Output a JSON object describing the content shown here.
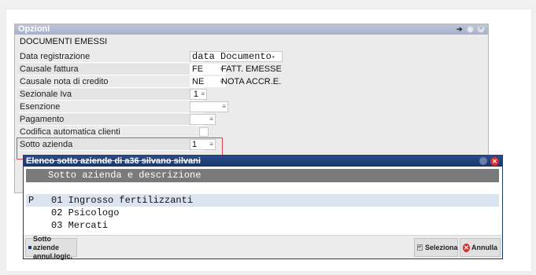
{
  "options_window": {
    "title": "Opzioni",
    "section": "DOCUMENTI EMESSI",
    "rows": [
      {
        "label": "Data registrazione",
        "value": "data Documento",
        "desc": ""
      },
      {
        "label": "Causale fattura",
        "value": "FE",
        "desc": "FATT. EMESSE"
      },
      {
        "label": "Causale nota di credito",
        "value": "NE",
        "desc": "NOTA ACCR.E."
      },
      {
        "label": "Sezionale Iva",
        "value": "1",
        "desc": ""
      },
      {
        "label": "Esenzione",
        "value": "",
        "desc": ""
      },
      {
        "label": "Pagamento",
        "value": "",
        "desc": ""
      },
      {
        "label": "Codifica automatica clienti",
        "value": "",
        "desc": ""
      },
      {
        "label": "Sotto azienda",
        "value": "1",
        "desc": ""
      }
    ],
    "list_marker": "≡",
    "dropdown_marker": "▾"
  },
  "popup": {
    "title": "Elenco sotto aziende di a36 silvano silvani",
    "column_header": "Sotto azienda e descrizione",
    "items": [
      {
        "flag": "P",
        "code": "01",
        "name": "Ingrosso fertilizzanti",
        "selected": true
      },
      {
        "flag": "",
        "code": "02",
        "name": "Psicologo",
        "selected": false
      },
      {
        "flag": "",
        "code": "03",
        "name": "Mercati",
        "selected": false
      }
    ],
    "footer": {
      "left_button_line1": "Sotto aziende",
      "left_button_line2": "annul.logic.",
      "select_label": "Seleziona",
      "cancel_label": "Annulla"
    }
  },
  "colors": {
    "popup_title_bg": "#1c3c72",
    "options_title_bg": "#a6b0cc",
    "highlight": "#e0464b",
    "cancel_red": "#d93030"
  }
}
